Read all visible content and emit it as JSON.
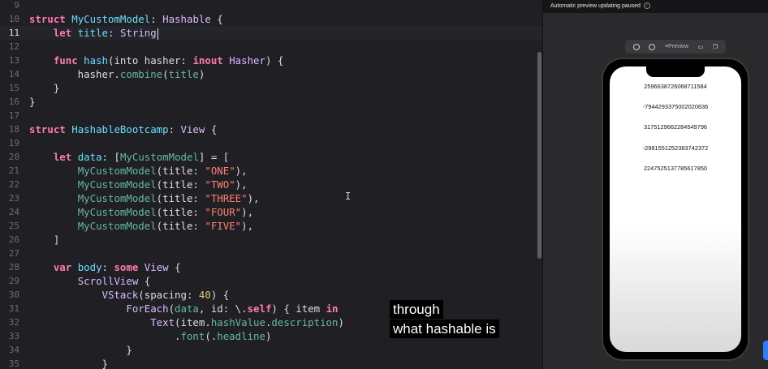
{
  "editor": {
    "lines": [
      {
        "num": "9",
        "tokens": []
      },
      {
        "num": "10",
        "tokens": [
          [
            "kw",
            "struct"
          ],
          [
            "plain",
            " "
          ],
          [
            "ident",
            "MyCustomModel"
          ],
          [
            "plain",
            ": "
          ],
          [
            "type",
            "Hashable"
          ],
          [
            "plain",
            " {"
          ]
        ]
      },
      {
        "num": "11",
        "tokens": [
          [
            "plain",
            "    "
          ],
          [
            "kw",
            "let"
          ],
          [
            "plain",
            " "
          ],
          [
            "ident",
            "title"
          ],
          [
            "plain",
            ": "
          ],
          [
            "type",
            "String"
          ]
        ],
        "active": true
      },
      {
        "num": "12",
        "tokens": []
      },
      {
        "num": "13",
        "tokens": [
          [
            "plain",
            "    "
          ],
          [
            "kw",
            "func"
          ],
          [
            "plain",
            " "
          ],
          [
            "ident",
            "hash"
          ],
          [
            "plain",
            "(into hasher: "
          ],
          [
            "kw",
            "inout"
          ],
          [
            "plain",
            " "
          ],
          [
            "type",
            "Hasher"
          ],
          [
            "plain",
            ") {"
          ]
        ]
      },
      {
        "num": "14",
        "tokens": [
          [
            "plain",
            "        hasher."
          ],
          [
            "fn",
            "combine"
          ],
          [
            "plain",
            "("
          ],
          [
            "fn",
            "title"
          ],
          [
            "plain",
            ")"
          ]
        ]
      },
      {
        "num": "15",
        "tokens": [
          [
            "plain",
            "    }"
          ]
        ]
      },
      {
        "num": "16",
        "tokens": [
          [
            "plain",
            "}"
          ]
        ]
      },
      {
        "num": "17",
        "tokens": []
      },
      {
        "num": "18",
        "tokens": [
          [
            "kw",
            "struct"
          ],
          [
            "plain",
            " "
          ],
          [
            "ident",
            "HashableBootcamp"
          ],
          [
            "plain",
            ": "
          ],
          [
            "type",
            "View"
          ],
          [
            "plain",
            " {"
          ]
        ]
      },
      {
        "num": "19",
        "tokens": []
      },
      {
        "num": "20",
        "tokens": [
          [
            "plain",
            "    "
          ],
          [
            "kw",
            "let"
          ],
          [
            "plain",
            " "
          ],
          [
            "ident",
            "data"
          ],
          [
            "plain",
            ": ["
          ],
          [
            "fn",
            "MyCustomModel"
          ],
          [
            "plain",
            "] = ["
          ]
        ]
      },
      {
        "num": "21",
        "tokens": [
          [
            "plain",
            "        "
          ],
          [
            "fn",
            "MyCustomModel"
          ],
          [
            "plain",
            "(title: "
          ],
          [
            "str",
            "\"ONE\""
          ],
          [
            "plain",
            "),"
          ]
        ]
      },
      {
        "num": "22",
        "tokens": [
          [
            "plain",
            "        "
          ],
          [
            "fn",
            "MyCustomModel"
          ],
          [
            "plain",
            "(title: "
          ],
          [
            "str",
            "\"TWO\""
          ],
          [
            "plain",
            "),"
          ]
        ]
      },
      {
        "num": "23",
        "tokens": [
          [
            "plain",
            "        "
          ],
          [
            "fn",
            "MyCustomModel"
          ],
          [
            "plain",
            "(title: "
          ],
          [
            "str",
            "\"THREE\""
          ],
          [
            "plain",
            "),"
          ]
        ]
      },
      {
        "num": "24",
        "tokens": [
          [
            "plain",
            "        "
          ],
          [
            "fn",
            "MyCustomModel"
          ],
          [
            "plain",
            "(title: "
          ],
          [
            "str",
            "\"FOUR\""
          ],
          [
            "plain",
            "),"
          ]
        ]
      },
      {
        "num": "25",
        "tokens": [
          [
            "plain",
            "        "
          ],
          [
            "fn",
            "MyCustomModel"
          ],
          [
            "plain",
            "(title: "
          ],
          [
            "str",
            "\"FIVE\""
          ],
          [
            "plain",
            "),"
          ]
        ]
      },
      {
        "num": "26",
        "tokens": [
          [
            "plain",
            "    ]"
          ]
        ]
      },
      {
        "num": "27",
        "tokens": []
      },
      {
        "num": "28",
        "tokens": [
          [
            "plain",
            "    "
          ],
          [
            "kw",
            "var"
          ],
          [
            "plain",
            " "
          ],
          [
            "ident",
            "body"
          ],
          [
            "plain",
            ": "
          ],
          [
            "kw",
            "some"
          ],
          [
            "plain",
            " "
          ],
          [
            "type",
            "View"
          ],
          [
            "plain",
            " {"
          ]
        ]
      },
      {
        "num": "29",
        "tokens": [
          [
            "plain",
            "        "
          ],
          [
            "type",
            "ScrollView"
          ],
          [
            "plain",
            " {"
          ]
        ]
      },
      {
        "num": "30",
        "tokens": [
          [
            "plain",
            "            "
          ],
          [
            "type",
            "VStack"
          ],
          [
            "plain",
            "(spacing: "
          ],
          [
            "num",
            "40"
          ],
          [
            "plain",
            ") {"
          ]
        ]
      },
      {
        "num": "31",
        "tokens": [
          [
            "plain",
            "                "
          ],
          [
            "type",
            "ForEach"
          ],
          [
            "plain",
            "("
          ],
          [
            "fn",
            "data"
          ],
          [
            "plain",
            ", id: \\."
          ],
          [
            "kw",
            "self"
          ],
          [
            "plain",
            ") { item "
          ],
          [
            "kw",
            "in"
          ]
        ]
      },
      {
        "num": "32",
        "tokens": [
          [
            "plain",
            "                    "
          ],
          [
            "type",
            "Text"
          ],
          [
            "plain",
            "(item."
          ],
          [
            "fn",
            "hashValue"
          ],
          [
            "plain",
            "."
          ],
          [
            "fn",
            "description"
          ],
          [
            "plain",
            ")"
          ]
        ]
      },
      {
        "num": "33",
        "tokens": [
          [
            "plain",
            "                        ."
          ],
          [
            "fn",
            "font"
          ],
          [
            "plain",
            "(."
          ],
          [
            "fn",
            "headline"
          ],
          [
            "plain",
            ")"
          ]
        ]
      },
      {
        "num": "34",
        "tokens": [
          [
            "plain",
            "                }"
          ]
        ]
      },
      {
        "num": "35",
        "tokens": [
          [
            "plain",
            "            }"
          ]
        ]
      }
    ]
  },
  "caption": {
    "line1": "through",
    "line2": "what hashable is"
  },
  "preview": {
    "status_text": "Automatic preview updating paused",
    "toolbar": {
      "preview_label": "Preview"
    },
    "hash_values": [
      "2596638726068711584",
      "-7944293375002020636",
      "3175129662284549796",
      "-2981551252383742372",
      "2247525137785617850"
    ]
  }
}
